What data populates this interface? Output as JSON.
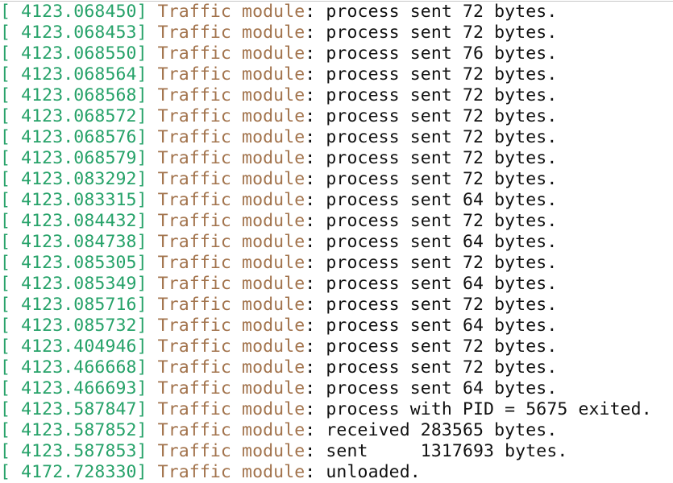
{
  "colors": {
    "timestamp": "#26a269",
    "module": "#a2734c",
    "text": "#111111",
    "background": "#ffffff"
  },
  "log": [
    {
      "ts": "[ 4123.068450]",
      "module": "Traffic module",
      "sep": ":",
      "msg": " process sent 72 bytes."
    },
    {
      "ts": "[ 4123.068453]",
      "module": "Traffic module",
      "sep": ":",
      "msg": " process sent 72 bytes."
    },
    {
      "ts": "[ 4123.068550]",
      "module": "Traffic module",
      "sep": ":",
      "msg": " process sent 76 bytes."
    },
    {
      "ts": "[ 4123.068564]",
      "module": "Traffic module",
      "sep": ":",
      "msg": " process sent 72 bytes."
    },
    {
      "ts": "[ 4123.068568]",
      "module": "Traffic module",
      "sep": ":",
      "msg": " process sent 72 bytes."
    },
    {
      "ts": "[ 4123.068572]",
      "module": "Traffic module",
      "sep": ":",
      "msg": " process sent 72 bytes."
    },
    {
      "ts": "[ 4123.068576]",
      "module": "Traffic module",
      "sep": ":",
      "msg": " process sent 72 bytes."
    },
    {
      "ts": "[ 4123.068579]",
      "module": "Traffic module",
      "sep": ":",
      "msg": " process sent 72 bytes."
    },
    {
      "ts": "[ 4123.083292]",
      "module": "Traffic module",
      "sep": ":",
      "msg": " process sent 72 bytes."
    },
    {
      "ts": "[ 4123.083315]",
      "module": "Traffic module",
      "sep": ":",
      "msg": " process sent 64 bytes."
    },
    {
      "ts": "[ 4123.084432]",
      "module": "Traffic module",
      "sep": ":",
      "msg": " process sent 72 bytes."
    },
    {
      "ts": "[ 4123.084738]",
      "module": "Traffic module",
      "sep": ":",
      "msg": " process sent 64 bytes."
    },
    {
      "ts": "[ 4123.085305]",
      "module": "Traffic module",
      "sep": ":",
      "msg": " process sent 72 bytes."
    },
    {
      "ts": "[ 4123.085349]",
      "module": "Traffic module",
      "sep": ":",
      "msg": " process sent 64 bytes."
    },
    {
      "ts": "[ 4123.085716]",
      "module": "Traffic module",
      "sep": ":",
      "msg": " process sent 72 bytes."
    },
    {
      "ts": "[ 4123.085732]",
      "module": "Traffic module",
      "sep": ":",
      "msg": " process sent 64 bytes."
    },
    {
      "ts": "[ 4123.404946]",
      "module": "Traffic module",
      "sep": ":",
      "msg": " process sent 72 bytes."
    },
    {
      "ts": "[ 4123.466668]",
      "module": "Traffic module",
      "sep": ":",
      "msg": " process sent 72 bytes."
    },
    {
      "ts": "[ 4123.466693]",
      "module": "Traffic module",
      "sep": ":",
      "msg": " process sent 64 bytes."
    },
    {
      "ts": "[ 4123.587847]",
      "module": "Traffic module",
      "sep": ":",
      "msg": " process with PID = 5675 exited."
    },
    {
      "ts": "[ 4123.587852]",
      "module": "Traffic module",
      "sep": ":",
      "msg": " received 283565 bytes."
    },
    {
      "ts": "[ 4123.587853]",
      "module": "Traffic module",
      "sep": ":",
      "msg": " sent     1317693 bytes."
    },
    {
      "ts": "[ 4172.728330]",
      "module": "Traffic module",
      "sep": ":",
      "msg": " unloaded."
    }
  ]
}
